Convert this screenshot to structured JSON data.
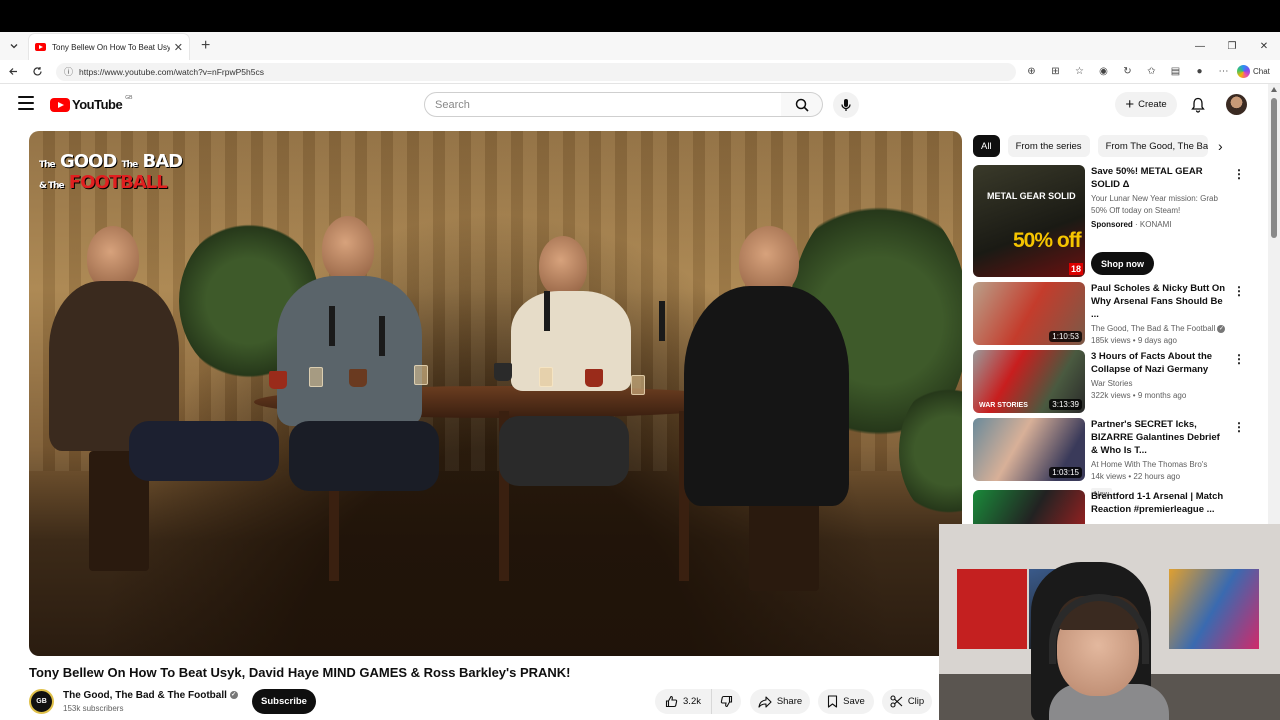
{
  "browser": {
    "tab_title": "Tony Bellew On How To Beat Usyk",
    "url": "https://www.youtube.com/watch?v=nFrpwP5h5cs",
    "chat_label": "Chat"
  },
  "youtube": {
    "logo_text": "YouTube",
    "country_code": "GB",
    "search_placeholder": "Search",
    "create_label": "Create"
  },
  "player": {
    "show_logo_line1": "GOOD",
    "show_logo_line1_prefix": "The",
    "show_logo_mid": "The",
    "show_logo_bad": "BAD",
    "show_logo_line2_prefix": "& The",
    "show_logo_football": "FOOTBALL"
  },
  "video": {
    "title": "Tony Bellew On How To Beat Usyk, David Haye MIND GAMES & Ross Barkley's PRANK!",
    "channel_name": "The Good, The Bad & The Football",
    "channel_avatar_text": "GB",
    "subscribers": "153k subscribers",
    "subscribe_label": "Subscribe",
    "likes": "3.2k",
    "share_label": "Share",
    "save_label": "Save",
    "clip_label": "Clip"
  },
  "chips": [
    {
      "label": "All",
      "active": true
    },
    {
      "label": "From the series",
      "active": false
    },
    {
      "label": "From The Good, The Bad",
      "active": false
    }
  ],
  "ad": {
    "title": "Save 50%! METAL GEAR SOLID Δ",
    "description": "Your Lunar New Year mission: Grab 50% Off today on Steam!",
    "sponsored": "Sponsored",
    "advertiser": "KONAMI",
    "cta": "Shop now",
    "thumb_title": "METAL GEAR SOLID",
    "thumb_offer": "50% off",
    "thumb_rating": "18"
  },
  "recommendations": [
    {
      "title": "Paul Scholes & Nicky Butt On Why Arsenal Fans Should Be ...",
      "channel": "The Good, The Bad & The Football",
      "verified": true,
      "views": "185k views",
      "age": "9 days ago",
      "duration": "1:10:53",
      "badge": ""
    },
    {
      "title": "3 Hours of Facts About the Collapse of Nazi Germany",
      "channel": "War Stories",
      "verified": false,
      "views": "322k views",
      "age": "9 months ago",
      "duration": "3:13:39",
      "badge": ""
    },
    {
      "title": "Partner's SECRET Icks, BIZARRE Galantines Debrief & Who Is T...",
      "channel": "At Home With The Thomas Bro's",
      "verified": false,
      "views": "14k views",
      "age": "22 hours ago",
      "duration": "1:03:15",
      "badge": "New"
    },
    {
      "title": "Brentford 1-1 Arsenal | Match Reaction #premierleague ...",
      "channel": "",
      "verified": false,
      "views": "",
      "age": "",
      "duration": "",
      "badge": ""
    }
  ],
  "colors": {
    "youtube_red": "#ff0000",
    "text_primary": "#0f0f0f",
    "text_secondary": "#606060",
    "chip_bg": "#f2f2f2"
  }
}
